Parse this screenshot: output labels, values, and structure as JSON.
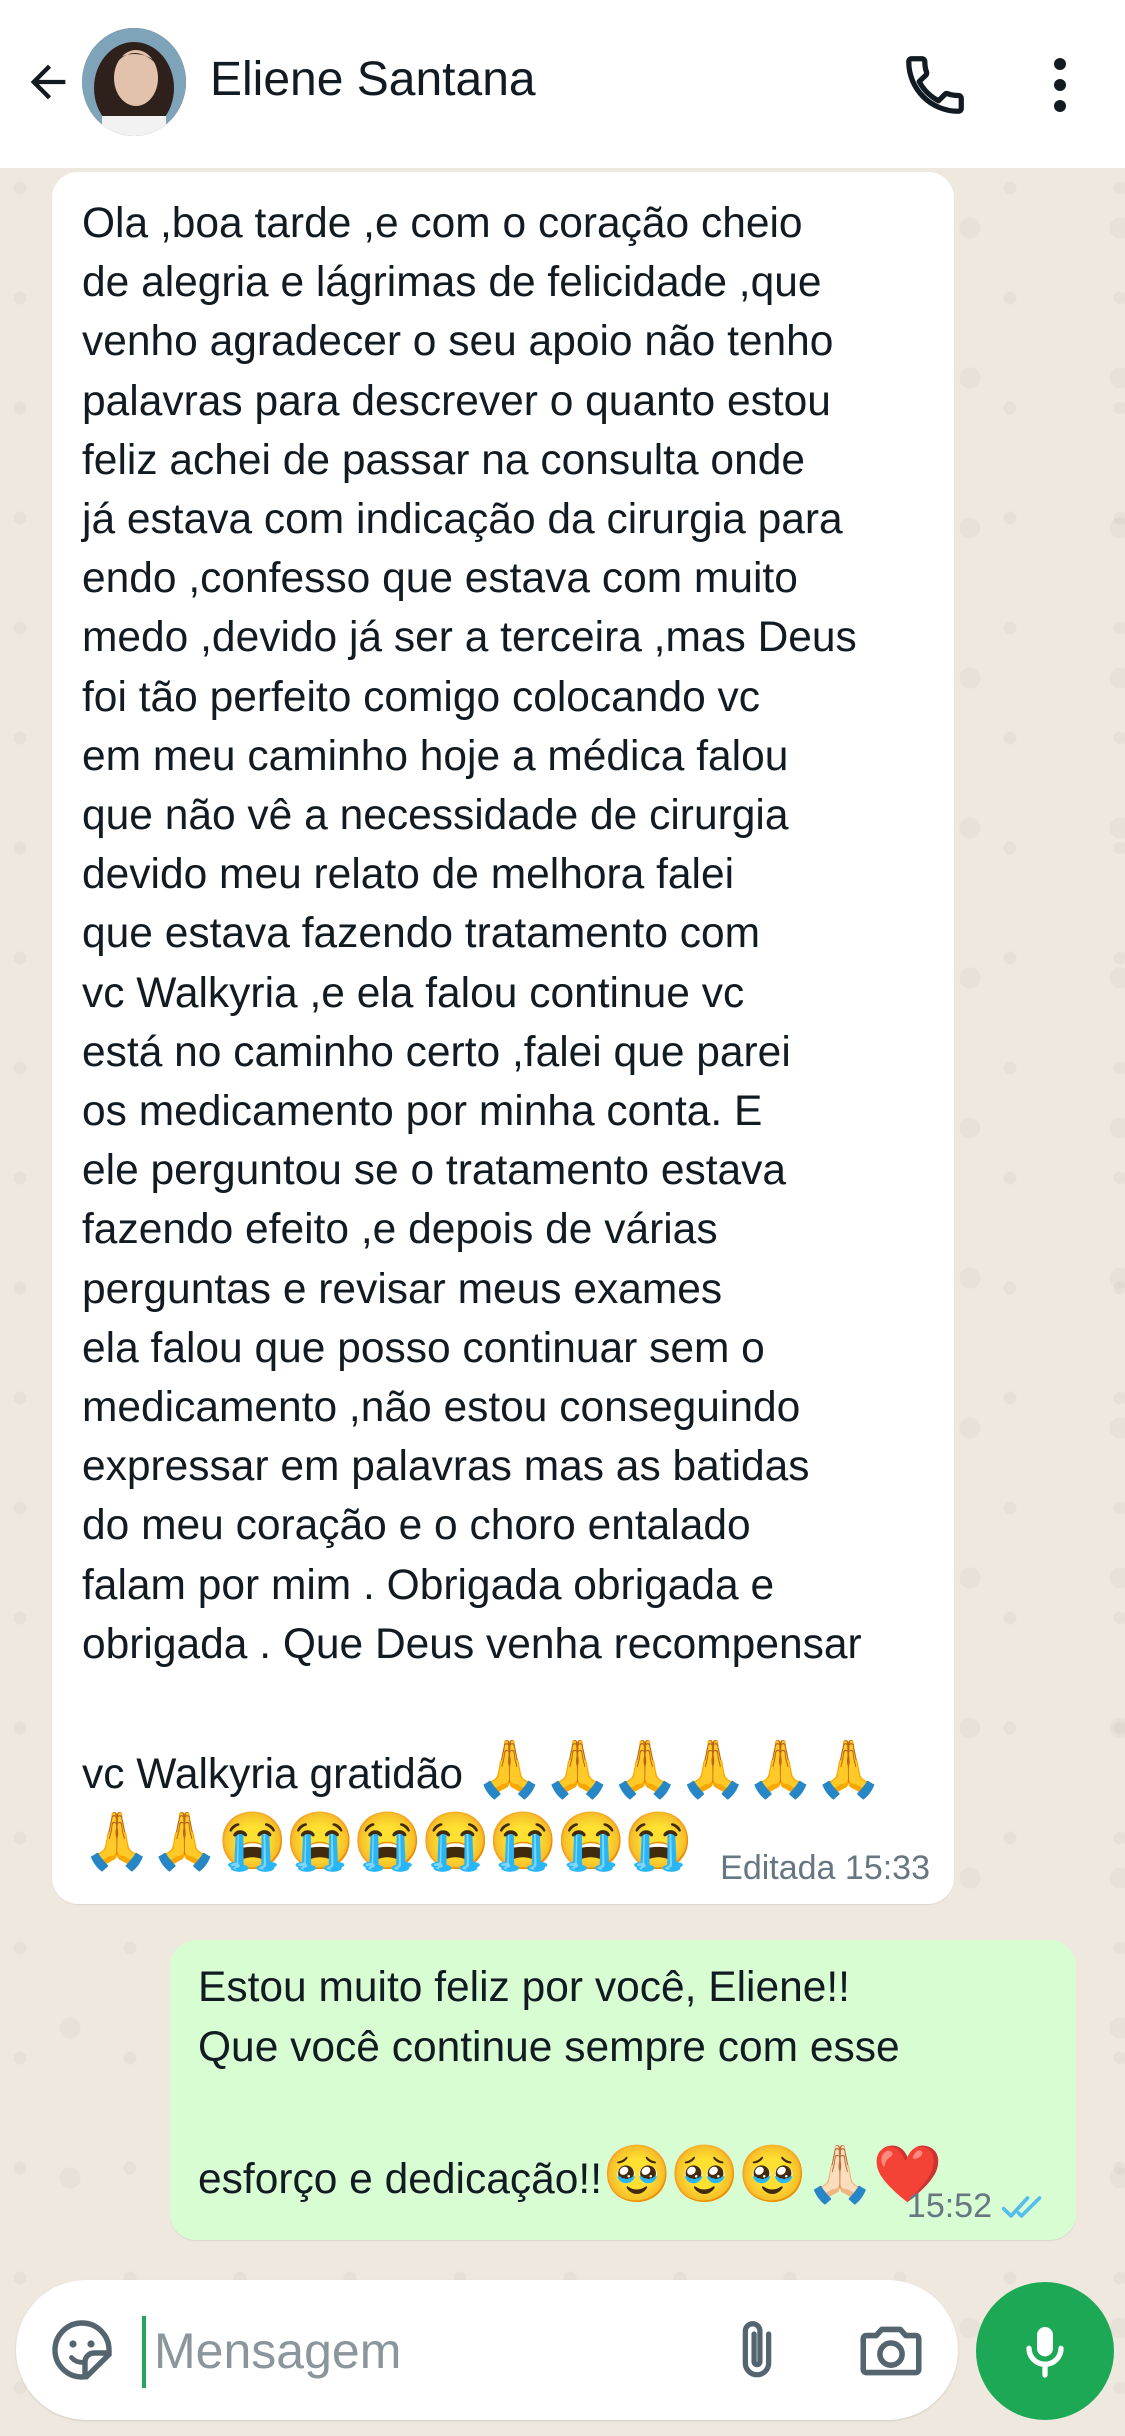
{
  "header": {
    "contact_name": "Eliene Santana"
  },
  "messages": {
    "incoming": {
      "text": "Ola ,boa tarde ,e com o coração cheio\nde alegria e lágrimas de felicidade ,que\nvenho agradecer o seu apoio não tenho\npalavras para descrever o quanto estou\nfeliz  achei de passar na consulta onde\njá estava com indicação da cirurgia para\nendo ,confesso que estava com muito\nmedo ,devido já ser a terceira ,mas Deus\nfoi tão perfeito comigo colocando vc\nem meu caminho hoje a médica falou\nque não vê a necessidade de cirurgia\ndevido meu relato de melhora  falei\nque estava fazendo tratamento com\nvc Walkyria ,e ela falou continue vc\nestá no caminho certo ,falei que parei\nos medicamento por minha conta. E\nele perguntou se o tratamento estava\nfazendo efeito ,e depois de várias\nperguntas e revisar meus exames\nela falou que posso continuar sem o\nmedicamento ,não estou conseguindo\nexpressar em palavras mas as batidas\ndo meu coração e o choro entalado\nfalam por mim . Obrigada obrigada e\nobrigada . Que Deus venha recompensar",
      "last_line_text": "vc Walkyria gratidão ",
      "last_line_emojis": "🙏🙏🙏🙏🙏🙏",
      "emoji_line": "🙏🙏😭😭😭😭😭😭😭",
      "meta": "Editada 15:33"
    },
    "outgoing": {
      "text": "Estou muito feliz por você, Eliene!!\nQue você continue sempre com esse",
      "last_line_text": "esforço e dedicação!!",
      "last_line_emojis": "🥹🥹🥹🙏🏻❤️",
      "time": "15:52",
      "status": "read"
    }
  },
  "composer": {
    "placeholder": "Mensagem"
  },
  "colors": {
    "incoming_bubble": "#ffffff",
    "outgoing_bubble": "#d9fdd3",
    "accent_green": "#1da856",
    "read_ticks": "#53bdeb",
    "chat_background": "#efe8de"
  },
  "icons": {
    "back": "arrow-left-icon",
    "call": "phone-icon",
    "menu": "more-vertical-icon",
    "emoji": "sticker-icon",
    "attach": "paperclip-icon",
    "camera": "camera-icon",
    "mic": "microphone-icon"
  }
}
